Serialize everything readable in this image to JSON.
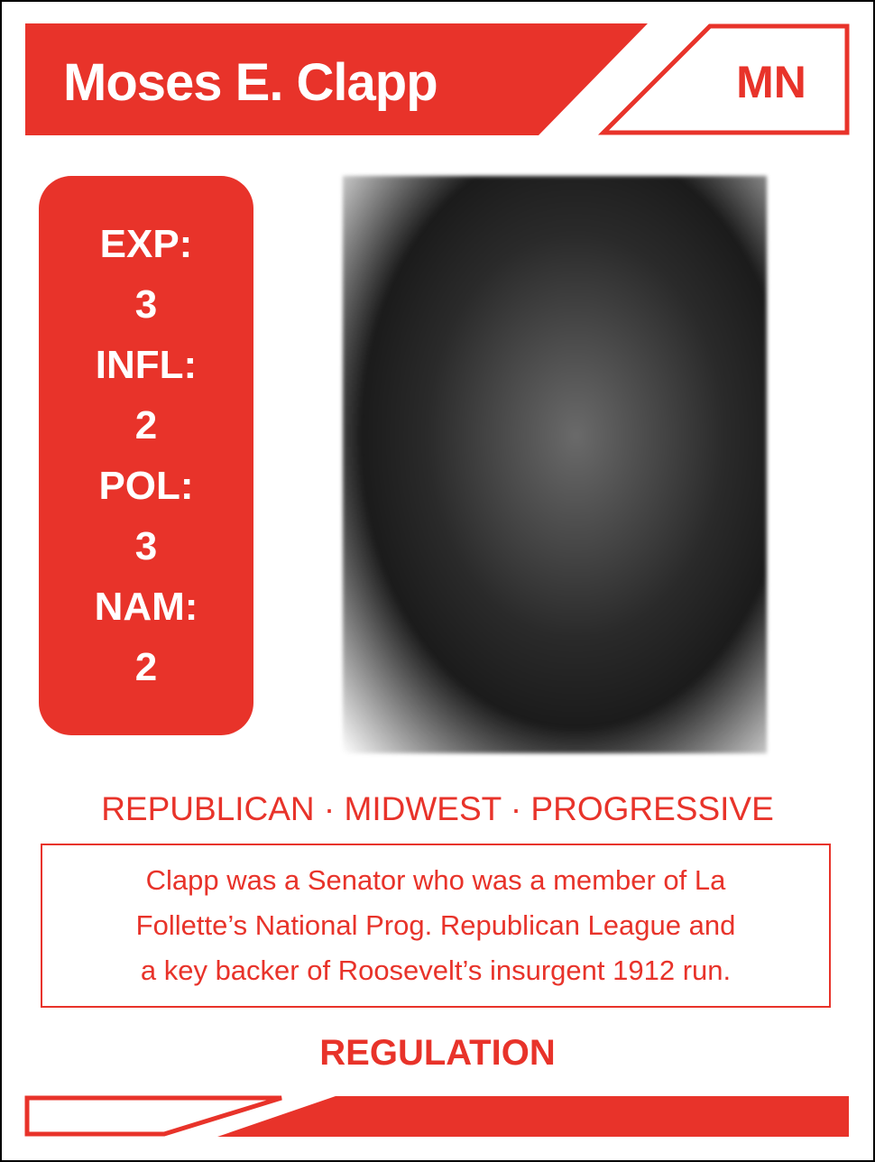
{
  "card": {
    "name": "Moses E. Clapp",
    "state": "MN",
    "stats": [
      {
        "label": "EXP:",
        "value": "3"
      },
      {
        "label": "INFL:",
        "value": "2"
      },
      {
        "label": "POL:",
        "value": "3"
      },
      {
        "label": "NAM:",
        "value": "2"
      }
    ],
    "tags": "REPUBLICAN · MIDWEST · PROGRESSIVE",
    "description_lines": [
      "Clapp was a Senator who was a member of La",
      "Follette’s National Prog. Republican League and",
      "a key backer of Roosevelt’s insurgent 1912 run."
    ],
    "theme": "REGULATION"
  },
  "colors": {
    "accent": "#e8332a"
  }
}
